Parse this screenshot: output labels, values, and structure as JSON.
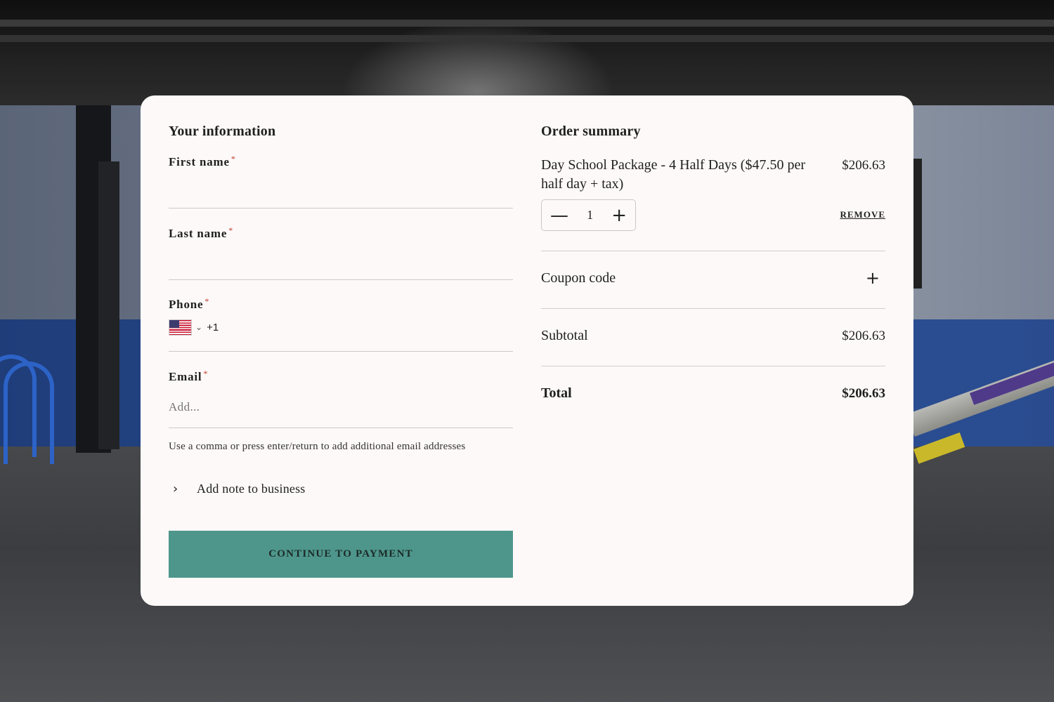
{
  "info": {
    "title": "Your information",
    "first_name_label": "First name",
    "last_name_label": "Last name",
    "phone_label": "Phone",
    "phone_dial_code": "+1",
    "phone_country": "US",
    "email_label": "Email",
    "email_placeholder": "Add...",
    "required_mark": "*",
    "email_help": "Use a comma or press enter/return to add additional email addresses",
    "add_note_label": "Add note to business",
    "continue_label": "CONTINUE TO PAYMENT"
  },
  "summary": {
    "title": "Order summary",
    "item_name": "Day School Package - 4 Half Days ($47.50 per half day + tax)",
    "item_price": "$206.63",
    "quantity": "1",
    "remove_label": "REMOVE",
    "coupon_label": "Coupon code",
    "subtotal_label": "Subtotal",
    "subtotal_value": "$206.63",
    "total_label": "Total",
    "total_value": "$206.63"
  },
  "colors": {
    "accent": "#4e968b",
    "required": "#c0392b",
    "card": "#fdf9f8"
  }
}
